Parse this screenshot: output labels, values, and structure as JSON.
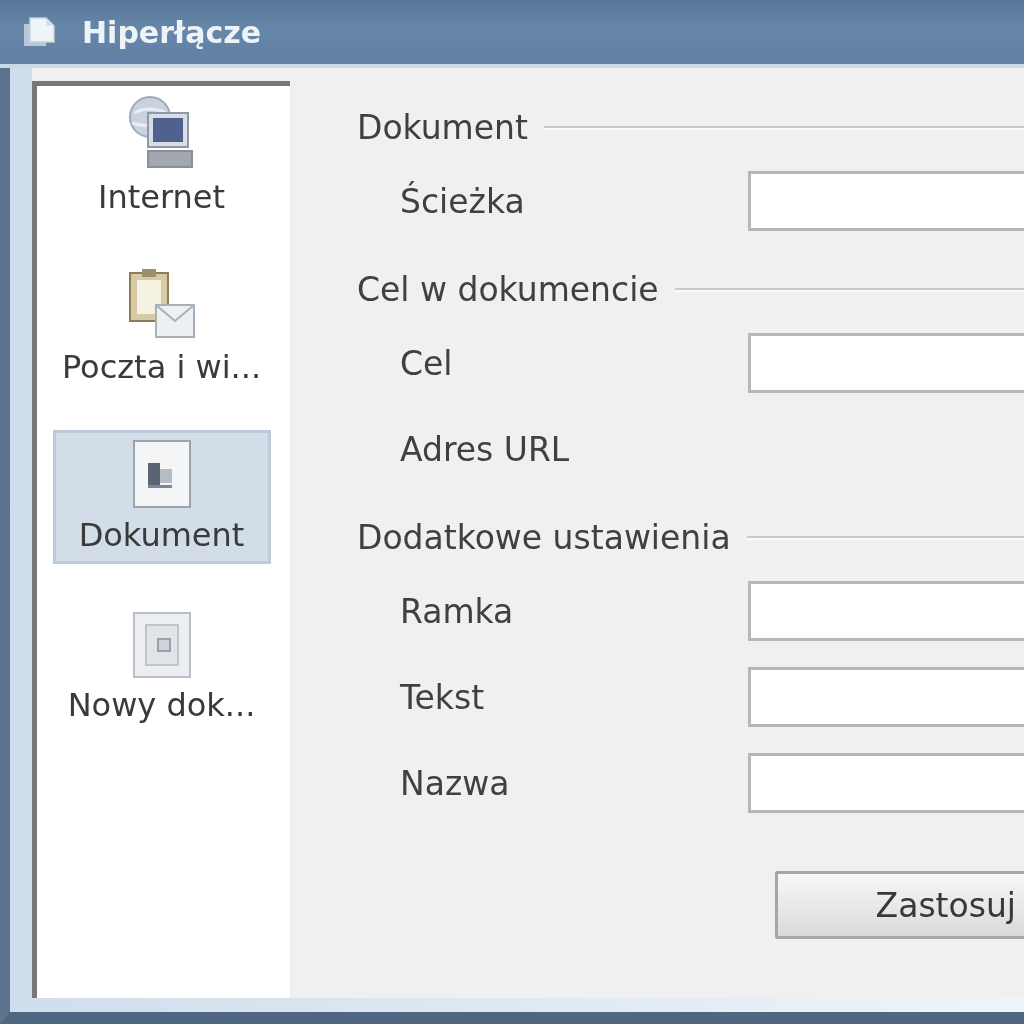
{
  "window": {
    "title": "Hiperłącze"
  },
  "sidebar": {
    "items": [
      {
        "label": "Internet",
        "kind": "internet",
        "selected": false
      },
      {
        "label": "Poczta i wi...",
        "kind": "mail",
        "selected": false
      },
      {
        "label": "Dokument",
        "kind": "document",
        "selected": true
      },
      {
        "label": "Nowy dok...",
        "kind": "new_document",
        "selected": false
      }
    ]
  },
  "sections": [
    {
      "title": "Dokument",
      "fields": [
        {
          "label": "Ścieżka",
          "kind": "input"
        }
      ]
    },
    {
      "title": "Cel w dokumencie",
      "fields": [
        {
          "label": "Cel",
          "kind": "input"
        },
        {
          "label": "Adres URL",
          "kind": "text"
        }
      ]
    },
    {
      "title": "Dodatkowe ustawienia",
      "fields": [
        {
          "label": "Ramka",
          "kind": "input"
        },
        {
          "label": "Tekst",
          "kind": "input"
        },
        {
          "label": "Nazwa",
          "kind": "input"
        }
      ]
    }
  ],
  "buttons": [
    {
      "label": "Zastosuj"
    }
  ]
}
